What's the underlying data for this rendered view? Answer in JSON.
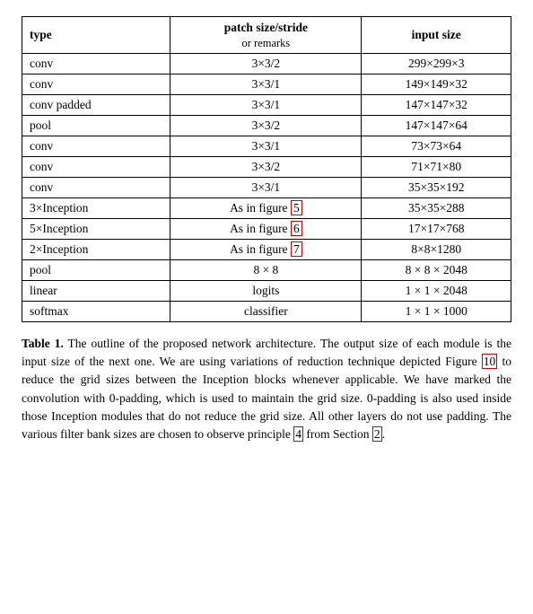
{
  "table": {
    "headers": {
      "col1": "type",
      "col2_main": "patch size/stride",
      "col2_sub": "or remarks",
      "col3": "input size"
    },
    "rows": [
      {
        "type": "conv",
        "patch": "3×3/2",
        "input": "299×299×3"
      },
      {
        "type": "conv",
        "patch": "3×3/1",
        "input": "149×149×32"
      },
      {
        "type": "conv padded",
        "patch": "3×3/1",
        "input": "147×147×32"
      },
      {
        "type": "pool",
        "patch": "3×3/2",
        "input": "147×147×64"
      },
      {
        "type": "conv",
        "patch": "3×3/1",
        "input": "73×73×64"
      },
      {
        "type": "conv",
        "patch": "3×3/2",
        "input": "71×71×80"
      },
      {
        "type": "conv",
        "patch": "3×3/1",
        "input": "35×35×192"
      },
      {
        "type": "3×Inception",
        "patch": "As in figure 5",
        "input": "35×35×288",
        "patch_highlight": true
      },
      {
        "type": "5×Inception",
        "patch": "As in figure 6",
        "input": "17×17×768",
        "patch_highlight": true
      },
      {
        "type": "2×Inception",
        "patch": "As in figure 7",
        "input": "8×8×1280",
        "patch_highlight": true
      },
      {
        "type": "pool",
        "patch": "8 × 8",
        "input": "8 × 8 × 2048"
      },
      {
        "type": "linear",
        "patch": "logits",
        "input": "1 × 1 × 2048"
      },
      {
        "type": "softmax",
        "patch": "classifier",
        "input": "1 × 1 × 1000"
      }
    ]
  },
  "caption": {
    "label": "Table 1.",
    "text": " The outline of the proposed network architecture.  The output size of each module is the input size of the next one.  We are using variations of reduction technique depicted Figure ",
    "ref1": "10",
    "text2": " to reduce the grid sizes between the Inception blocks whenever applicable.  We have marked the convolution with 0-padding, which is used to maintain the grid size.  0-padding is also used inside those Inception modules that do not reduce the grid size.  All other layers do not use padding.  The various filter bank sizes are chosen to observe principle ",
    "ref2": "4",
    "text3": " from Section ",
    "ref3": "2",
    "text4": "."
  }
}
